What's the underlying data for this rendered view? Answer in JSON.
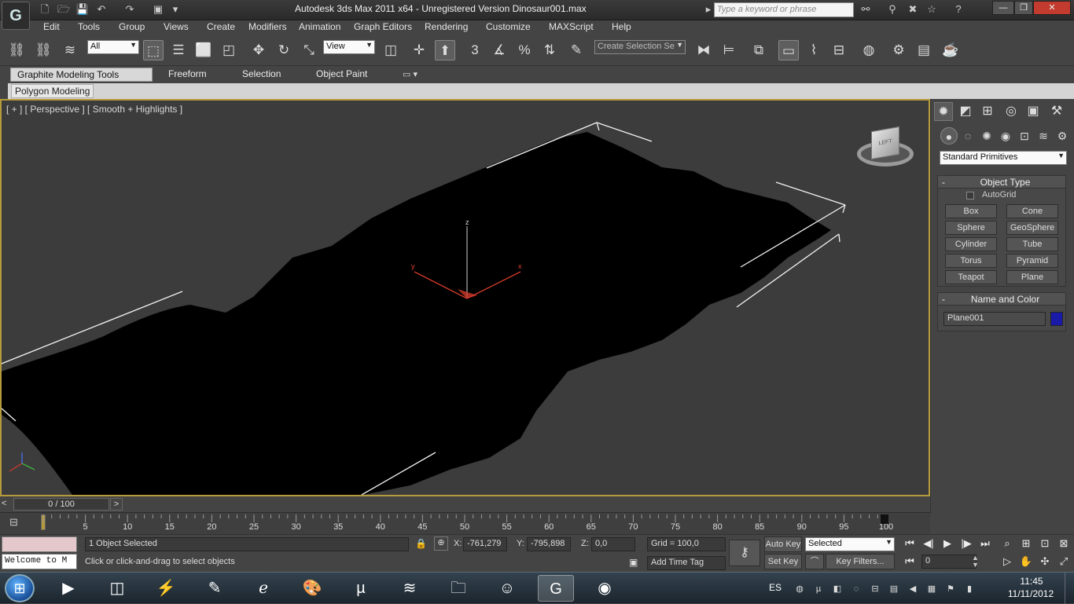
{
  "window": {
    "title": "Autodesk 3ds Max  2011 x64  - Unregistered Version   Dinosaur001.max",
    "search_placeholder": "Type a keyword or phrase",
    "app_logo": "G"
  },
  "menu": [
    "Edit",
    "Tools",
    "Group",
    "Views",
    "Create",
    "Modifiers",
    "Animation",
    "Graph Editors",
    "Rendering",
    "Customize",
    "MAXScript",
    "Help"
  ],
  "toolbar": {
    "filter_value": "All",
    "coord_value": "View",
    "selection_set_placeholder": "Create Selection Se",
    "snap_label": "3"
  },
  "ribbon": {
    "tabs": [
      "Graphite Modeling Tools",
      "Freeform",
      "Selection",
      "Object Paint"
    ],
    "panel_label": "Polygon Modeling"
  },
  "viewport": {
    "label": "[ + ] [ Perspective ] [ Smooth + Highlights ]",
    "axis_x": "x",
    "axis_y": "y",
    "axis_z": "z",
    "viewcube_label": "LEFT"
  },
  "command_panel": {
    "category": "Standard Primitives",
    "object_type_header": "Object Type",
    "autogrid_label": "AutoGrid",
    "primitives": [
      "Box",
      "Cone",
      "Sphere",
      "GeoSphere",
      "Cylinder",
      "Tube",
      "Torus",
      "Pyramid",
      "Teapot",
      "Plane"
    ],
    "name_color_header": "Name and Color",
    "object_name": "Plane001",
    "object_color": "#1a1aa8"
  },
  "timeline": {
    "position_label": "0 / 100",
    "ticks": [
      "5",
      "10",
      "15",
      "20",
      "25",
      "30",
      "35",
      "40",
      "45",
      "50",
      "55",
      "60",
      "65",
      "70",
      "75",
      "80",
      "85",
      "90",
      "95",
      "100"
    ],
    "current_frame": 0,
    "total_frames": 100
  },
  "status": {
    "maxscript_listener": "Welcome to M",
    "selection_text": "1 Object Selected",
    "prompt_text": "Click or click-and-drag to select objects",
    "x_label": "X:",
    "x_value": "-761,279",
    "y_label": "Y:",
    "y_value": "-795,898",
    "z_label": "Z:",
    "z_value": "0,0",
    "grid_text": "Grid = 100,0",
    "add_time_tag": "Add Time Tag",
    "auto_key": "Auto Key",
    "set_key": "Set Key",
    "key_mode": "Selected",
    "key_filters": "Key Filters...",
    "frame_value": "0"
  },
  "taskbar": {
    "language": "ES",
    "time": "11:45",
    "date": "11/11/2012"
  },
  "colors": {
    "viewport_border": "#b59b3c",
    "x_axis": "#d23a2a",
    "mesh": "#000000"
  }
}
